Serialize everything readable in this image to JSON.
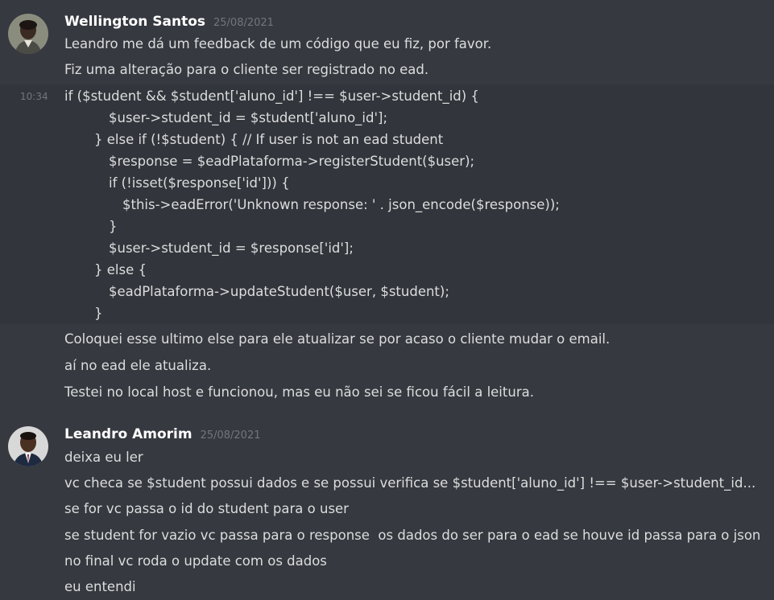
{
  "messages": [
    {
      "author": "Wellington Santos",
      "timestamp": "25/08/2021",
      "hover_time": "10:34",
      "intro_lines": [
        "Leandro me dá um feedback de um código que eu fiz, por favor.",
        "Fiz uma alteração para o cliente ser registrado no ead."
      ],
      "code_lines": [
        "if ($student && $student['aluno_id'] !== $user->student_id) {",
        "$user->student_id = $student['aluno_id'];",
        "} else if (!$student) { // If user is not an ead student",
        "$response = $eadPlataforma->registerStudent($user);",
        "if (!isset($response['id'])) {",
        "$this->eadError('Unknown response: ' . json_encode($response));",
        "}",
        "$user->student_id = $response['id'];",
        "} else {",
        "$eadPlataforma->updateStudent($user, $student);",
        "}"
      ],
      "outro_lines": [
        "Coloquei esse ultimo else para ele atualizar se por acaso o cliente mudar o email.",
        "aí no ead ele atualiza.",
        "Testei no local host e funcionou, mas eu não sei se ficou fácil a leitura."
      ]
    },
    {
      "author": "Leandro Amorim",
      "timestamp": "25/08/2021",
      "lines": [
        "deixa eu ler",
        "vc checa se $student possui dados e se possui verifica se $student['aluno_id'] !== $user->student_id...",
        "se for vc passa o id do student para o user",
        "se student for vazio vc passa para o response  os dados do ser para o ead se houve id passa para o json",
        "no final vc roda o update com os dados",
        "eu entendi"
      ]
    }
  ],
  "colors": {
    "background": "#36393f",
    "hover_background": "#32353b",
    "author": "#ffffff",
    "text": "#dcddde",
    "muted": "#72767d"
  }
}
